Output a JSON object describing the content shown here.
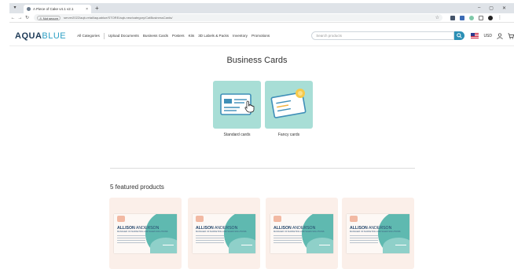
{
  "browser": {
    "tab_title": "A Piece of Cake v4.1 v2.1",
    "tab_close": "×",
    "new_tab": "+",
    "security_label": "Not secure",
    "url": "server2022/aqb-retail/aquablue/STORE/aqb-new/category/CatBusinessCards/",
    "win_controls": [
      "–",
      "▢",
      "✕"
    ]
  },
  "site": {
    "logo_part1": "AQUA",
    "logo_part2": "BLUE",
    "nav": {
      "all_categories": "All Categories",
      "items": [
        "Upload Documents",
        "Business Cards",
        "Posters",
        "Kits",
        "3D Labels & Packs",
        "Inventory",
        "Promotions"
      ]
    },
    "search": {
      "placeholder": "Search products"
    },
    "currency": "USD"
  },
  "main": {
    "title": "Business Cards",
    "categories": [
      {
        "label": "Standard cards"
      },
      {
        "label": "Fancy cards"
      }
    ],
    "featured_heading": "5 featured products",
    "products": [
      {
        "card_name_first": "ALLISON",
        "card_name_last": "ANDERSON",
        "card_role": "MANAGER OF MARKETING AND SALES SOLUTIONS"
      },
      {
        "card_name_first": "ALLISON",
        "card_name_last": "ANDERSON",
        "card_role": "MANAGER OF MARKETING AND SALES SOLUTIONS"
      },
      {
        "card_name_first": "ALLISON",
        "card_name_last": "ANDERSON",
        "card_role": "MANAGER OF MARKETING AND SALES SOLUTIONS"
      },
      {
        "card_name_first": "ALLISON",
        "card_name_last": "ANDERSON",
        "card_role": "MANAGER OF MARKETING AND SALES SOLUTIONS"
      }
    ]
  },
  "colors": {
    "brand_dark": "#1d3a57",
    "brand_light": "#2b9fc4",
    "category_tile": "#a8ded6",
    "product_bg": "#fbefe9",
    "card_teal": "#5fb9b0"
  },
  "icons": [
    "menu-icon",
    "back-icon",
    "forward-icon",
    "reload-icon",
    "star-icon",
    "search-icon",
    "flag-icon",
    "user-icon",
    "cart-icon",
    "id-card-icon",
    "fancy-card-icon",
    "cursor-hand-icon"
  ]
}
